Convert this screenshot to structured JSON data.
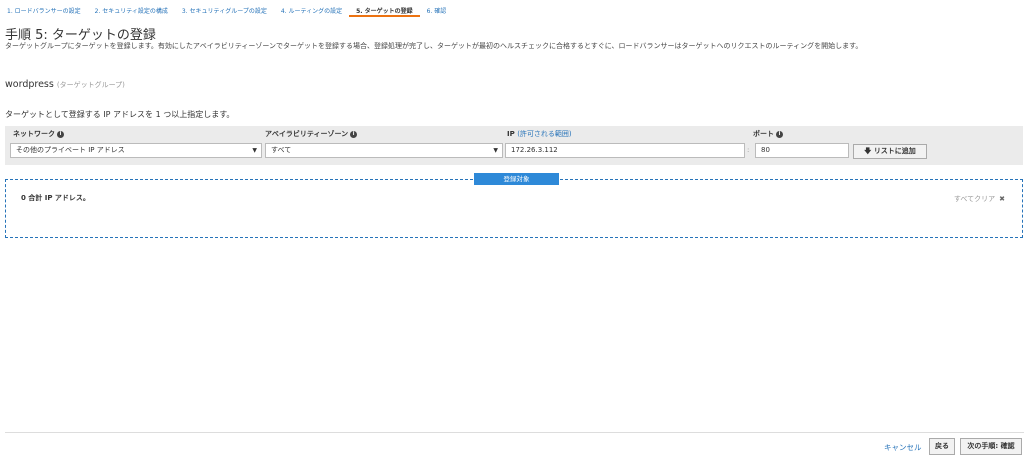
{
  "steps": [
    {
      "label": "1. ロードバランサーの設定"
    },
    {
      "label": "2. セキュリティ設定の構成"
    },
    {
      "label": "3. セキュリティグループの設定"
    },
    {
      "label": "4. ルーティングの設定"
    },
    {
      "label": "5. ターゲットの登録"
    },
    {
      "label": "6. 確認"
    }
  ],
  "page": {
    "title": "手順 5: ターゲットの登録",
    "description": "ターゲットグループにターゲットを登録します。有効にしたアベイラビリティーゾーンでターゲットを登録する場合、登録処理が完了し、ターゲットが最初のヘルスチェックに合格するとすぐに、ロードバランサーはターゲットへのリクエストのルーティングを開始します。"
  },
  "target_group": {
    "name": "wordpress",
    "type": "(ターゲットグループ)"
  },
  "instruction": "ターゲットとして登録する IP アドレスを 1 つ以上指定します。",
  "form": {
    "network_label": "ネットワーク",
    "network_value": "その他のプライベート IP アドレス",
    "az_label": "アベイラビリティーゾーン",
    "az_value": "すべて",
    "ip_label": "IP",
    "ip_range_link": "(許可される範囲)",
    "ip_value": "172.26.3.112",
    "port_label": "ポート",
    "port_value": "80",
    "add_button": "リストに追加",
    "info_glyph": "i",
    "caret_glyph": "▼"
  },
  "registered": {
    "tab_label": "登録対象",
    "total_text": "0 合計 IP アドレス。",
    "clear_all": "すべてクリア"
  },
  "footer": {
    "cancel": "キャンセル",
    "back": "戻る",
    "next": "次の手順: 確認"
  }
}
